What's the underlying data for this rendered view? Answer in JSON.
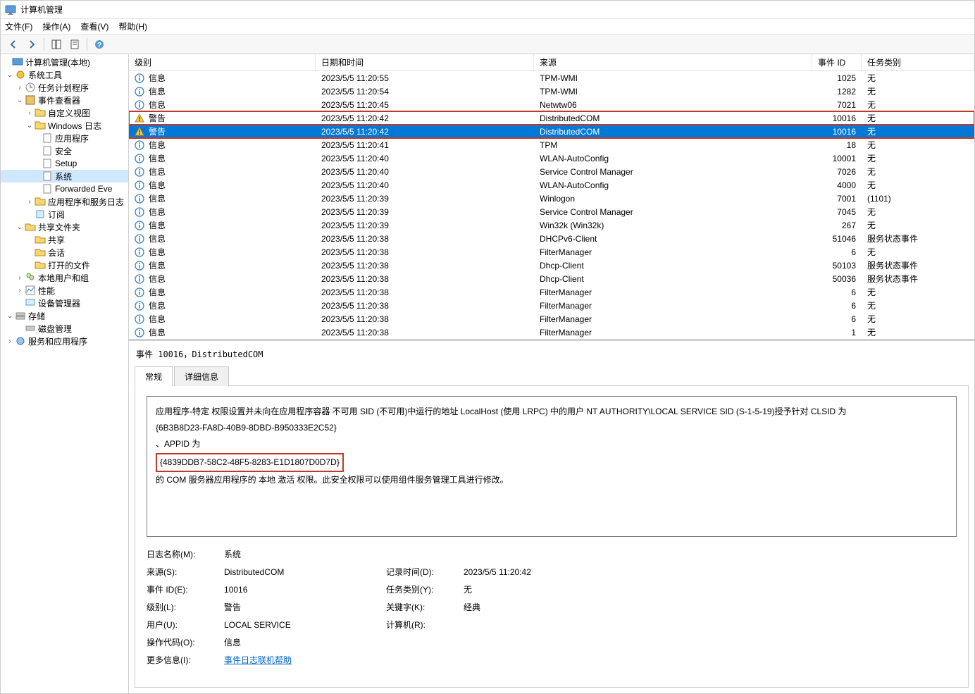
{
  "window": {
    "title": "计算机管理"
  },
  "menu": {
    "file": "文件(F)",
    "action": "操作(A)",
    "view": "查看(V)",
    "help": "帮助(H)"
  },
  "tree": {
    "root": "计算机管理(本地)",
    "system_tools": "系统工具",
    "task_scheduler": "任务计划程序",
    "event_viewer": "事件查看器",
    "custom_views": "自定义视图",
    "windows_logs": "Windows 日志",
    "app_log": "应用程序",
    "security_log": "安全",
    "setup_log": "Setup",
    "system_log": "系统",
    "forwarded": "Forwarded Eve",
    "app_service_logs": "应用程序和服务日志",
    "subscriptions": "订阅",
    "shared_folders": "共享文件夹",
    "shares": "共享",
    "sessions": "会话",
    "open_files": "打开的文件",
    "local_users": "本地用户和组",
    "performance": "性能",
    "device_manager": "设备管理器",
    "storage": "存储",
    "disk_management": "磁盘管理",
    "services_apps": "服务和应用程序"
  },
  "columns": {
    "level": "级别",
    "datetime": "日期和时间",
    "source": "来源",
    "eventid": "事件 ID",
    "category": "任务类别"
  },
  "levels": {
    "info": "信息",
    "warning": "警告"
  },
  "events": [
    {
      "lv": "info",
      "dt": "2023/5/5 11:20:55",
      "src": "TPM-WMI",
      "id": "1025",
      "cat": "无"
    },
    {
      "lv": "info",
      "dt": "2023/5/5 11:20:54",
      "src": "TPM-WMI",
      "id": "1282",
      "cat": "无"
    },
    {
      "lv": "info",
      "dt": "2023/5/5 11:20:45",
      "src": "Netwtw06",
      "id": "7021",
      "cat": "无"
    },
    {
      "lv": "warning",
      "dt": "2023/5/5 11:20:42",
      "src": "DistributedCOM",
      "id": "10016",
      "cat": "无",
      "boxed": true
    },
    {
      "lv": "warning",
      "dt": "2023/5/5 11:20:42",
      "src": "DistributedCOM",
      "id": "10016",
      "cat": "无",
      "selected": true,
      "boxed": true
    },
    {
      "lv": "info",
      "dt": "2023/5/5 11:20:41",
      "src": "TPM",
      "id": "18",
      "cat": "无"
    },
    {
      "lv": "info",
      "dt": "2023/5/5 11:20:40",
      "src": "WLAN-AutoConfig",
      "id": "10001",
      "cat": "无"
    },
    {
      "lv": "info",
      "dt": "2023/5/5 11:20:40",
      "src": "Service Control Manager",
      "id": "7026",
      "cat": "无"
    },
    {
      "lv": "info",
      "dt": "2023/5/5 11:20:40",
      "src": "WLAN-AutoConfig",
      "id": "4000",
      "cat": "无"
    },
    {
      "lv": "info",
      "dt": "2023/5/5 11:20:39",
      "src": "Winlogon",
      "id": "7001",
      "cat": "(1101)"
    },
    {
      "lv": "info",
      "dt": "2023/5/5 11:20:39",
      "src": "Service Control Manager",
      "id": "7045",
      "cat": "无"
    },
    {
      "lv": "info",
      "dt": "2023/5/5 11:20:39",
      "src": "Win32k (Win32k)",
      "id": "267",
      "cat": "无"
    },
    {
      "lv": "info",
      "dt": "2023/5/5 11:20:38",
      "src": "DHCPv6-Client",
      "id": "51046",
      "cat": "服务状态事件"
    },
    {
      "lv": "info",
      "dt": "2023/5/5 11:20:38",
      "src": "FilterManager",
      "id": "6",
      "cat": "无"
    },
    {
      "lv": "info",
      "dt": "2023/5/5 11:20:38",
      "src": "Dhcp-Client",
      "id": "50103",
      "cat": "服务状态事件"
    },
    {
      "lv": "info",
      "dt": "2023/5/5 11:20:38",
      "src": "Dhcp-Client",
      "id": "50036",
      "cat": "服务状态事件"
    },
    {
      "lv": "info",
      "dt": "2023/5/5 11:20:38",
      "src": "FilterManager",
      "id": "6",
      "cat": "无"
    },
    {
      "lv": "info",
      "dt": "2023/5/5 11:20:38",
      "src": "FilterManager",
      "id": "6",
      "cat": "无"
    },
    {
      "lv": "info",
      "dt": "2023/5/5 11:20:38",
      "src": "FilterManager",
      "id": "6",
      "cat": "无"
    },
    {
      "lv": "info",
      "dt": "2023/5/5 11:20:38",
      "src": "FilterManager",
      "id": "1",
      "cat": "无"
    }
  ],
  "detail": {
    "title": "事件 10016，DistributedCOM",
    "tab_general": "常规",
    "tab_details": "详细信息",
    "msg_line1": "应用程序-特定 权限设置并未向在应用程序容器 不可用 SID (不可用)中运行的地址 LocalHost (使用 LRPC) 中的用户 NT AUTHORITY\\LOCAL SERVICE SID (S-1-5-19)授予针对 CLSID 为",
    "msg_line2": "{6B3B8D23-FA8D-40B9-8DBD-B950333E2C52}",
    "msg_line3": "、APPID 为",
    "msg_line4": "{4839DDB7-58C2-48F5-8283-E1D1807D0D7D}",
    "msg_line5": "的 COM 服务器应用程序的 本地 激活 权限。此安全权限可以使用组件服务管理工具进行修改。",
    "labels": {
      "logname": "日志名称(M):",
      "logname_v": "系统",
      "source": "来源(S):",
      "source_v": "DistributedCOM",
      "logged": "记录时间(D):",
      "logged_v": "2023/5/5 11:20:42",
      "eventid": "事件 ID(E):",
      "eventid_v": "10016",
      "category": "任务类别(Y):",
      "category_v": "无",
      "level": "级别(L):",
      "level_v": "警告",
      "keywords": "关键字(K):",
      "keywords_v": "经典",
      "user": "用户(U):",
      "user_v": "LOCAL SERVICE",
      "computer": "计算机(R):",
      "computer_v": " ",
      "opcode": "操作代码(O):",
      "opcode_v": "信息",
      "moreinfo": "更多信息(I):",
      "moreinfo_link": "事件日志联机帮助"
    }
  }
}
